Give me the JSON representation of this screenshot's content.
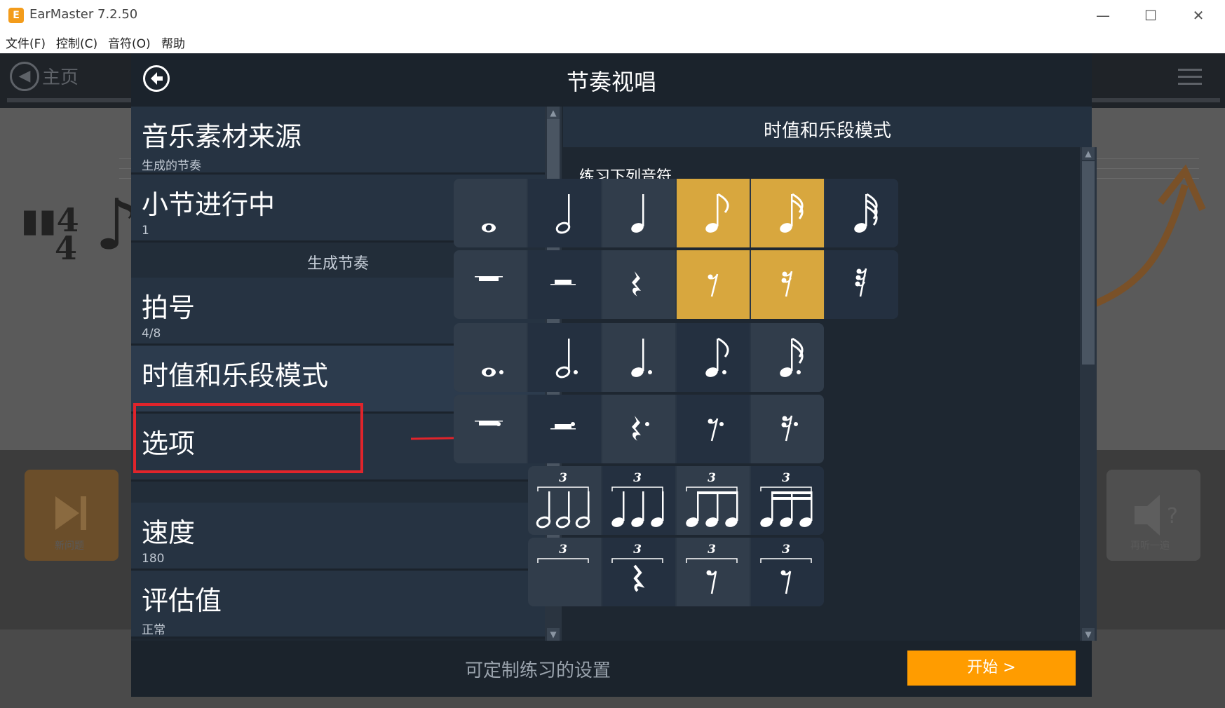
{
  "window": {
    "title": "EarMaster 7.2.50",
    "icon": "E",
    "minimize": "—",
    "maximize": "☐",
    "close": "✕"
  },
  "menu": [
    "文件(F)",
    "控制(C)",
    "音符(O)",
    "帮助"
  ],
  "background": {
    "home": "主页",
    "home_icon": "◀",
    "new_question": "新问题",
    "right_tile": "再听一遍"
  },
  "modal": {
    "title": "节奏视唱",
    "left": {
      "items": [
        {
          "label": "音乐素材来源",
          "sub": "生成的节奏"
        },
        {
          "label": "小节进行中",
          "sub": "1"
        },
        {
          "section": "生成节奏"
        },
        {
          "label": "拍号",
          "sub": "4/8"
        },
        {
          "label": "时值和乐段模式",
          "sub": ""
        },
        {
          "label": "选项",
          "sub": ""
        },
        {
          "label": "速度",
          "sub": "180"
        },
        {
          "label": "评估值",
          "sub": "正常"
        }
      ]
    },
    "right": {
      "header": "时值和乐段模式",
      "practice_label": "练习下列音符",
      "rows": [
        {
          "name": "notes",
          "cells": [
            "whole-note",
            "half-note",
            "quarter-note",
            "eighth-note",
            "sixteenth-note",
            "thirty-second-note"
          ],
          "selected": [
            false,
            false,
            false,
            true,
            true,
            false
          ]
        },
        {
          "name": "rests",
          "cells": [
            "whole-rest",
            "half-rest",
            "quarter-rest",
            "eighth-rest",
            "sixteenth-rest",
            "thirty-second-rest"
          ],
          "selected": [
            false,
            false,
            false,
            true,
            true,
            false
          ]
        },
        {
          "name": "dotted-notes",
          "cells": [
            "dotted-whole-note",
            "dotted-half-note",
            "dotted-quarter-note",
            "dotted-eighth-note",
            "dotted-sixteenth-note"
          ],
          "selected": [
            false,
            false,
            false,
            false,
            false
          ]
        },
        {
          "name": "dotted-rests",
          "cells": [
            "dotted-whole-rest",
            "dotted-half-rest",
            "dotted-quarter-rest",
            "dotted-eighth-rest",
            "dotted-sixteenth-rest"
          ],
          "selected": [
            false,
            false,
            false,
            false,
            false
          ]
        },
        {
          "name": "triplets",
          "cells": [
            "half-triplet",
            "quarter-triplet",
            "eighth-triplet",
            "sixteenth-triplet"
          ],
          "selected": [
            false,
            false,
            false,
            false
          ]
        },
        {
          "name": "triplets-rests",
          "cells": [
            "half-triplet-rest",
            "quarter-triplet-rest",
            "eighth-triplet-rest",
            "sixteenth-triplet-rest"
          ],
          "selected": [
            false,
            false,
            false,
            false
          ]
        }
      ],
      "triplet_number": "3"
    },
    "footer": {
      "hint": "可定制练习的设置",
      "start": "开始 >"
    }
  },
  "colors": {
    "selected": "#d8a73e",
    "start": "#ff9c00",
    "highlight": "#e0242b"
  }
}
